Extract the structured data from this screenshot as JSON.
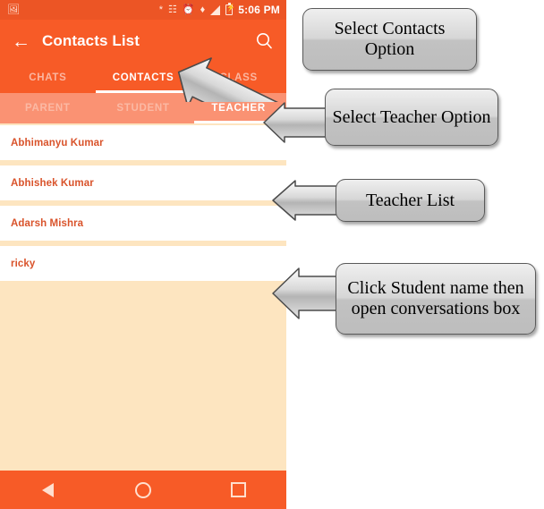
{
  "phone": {
    "statusbar": {
      "icons": [
        "image-icon",
        "bluetooth-icon",
        "vibrate-icon",
        "alarm-icon",
        "gps-icon",
        "signal-icon",
        "battery-charging-icon"
      ],
      "time": "5:06 PM"
    },
    "appbar": {
      "back_icon": "back-arrow-icon",
      "title": "Contacts List",
      "search_icon": "search-icon"
    },
    "main_tabs": [
      {
        "label": "CHATS",
        "active": false
      },
      {
        "label": "CONTACTS",
        "active": true
      },
      {
        "label": "CLASS",
        "active": false
      }
    ],
    "sub_tabs": [
      {
        "label": "PARENT",
        "active": false
      },
      {
        "label": "STUDENT",
        "active": false
      },
      {
        "label": "TEACHER",
        "active": true
      }
    ],
    "contacts": [
      {
        "name": "Abhimanyu Kumar"
      },
      {
        "name": "Abhishek Kumar"
      },
      {
        "name": "Adarsh Mishra"
      },
      {
        "name": "ricky"
      }
    ],
    "navbar": [
      {
        "icon": "nav-back-icon"
      },
      {
        "icon": "nav-home-icon"
      },
      {
        "icon": "nav-recent-icon"
      }
    ]
  },
  "annotations": [
    {
      "text": "Select Contacts Option",
      "arrow": "arrow-diagonal-down-left"
    },
    {
      "text": "Select Teacher Option",
      "arrow": "arrow-left"
    },
    {
      "text": "Teacher List",
      "arrow": "arrow-left"
    },
    {
      "text": "Click Student name then open conversations box",
      "arrow": "arrow-left"
    }
  ],
  "colors": {
    "app_bar": "#F75B27",
    "status_bar": "#EC5525",
    "sub_tab_bar": "#FA9273",
    "page_background": "#FDE5C0",
    "contact_name": "#D9532B",
    "callout_fill": "#D6D6D6",
    "callout_border": "#5A5A5A",
    "arrow_fill": "#C9C9C9"
  }
}
